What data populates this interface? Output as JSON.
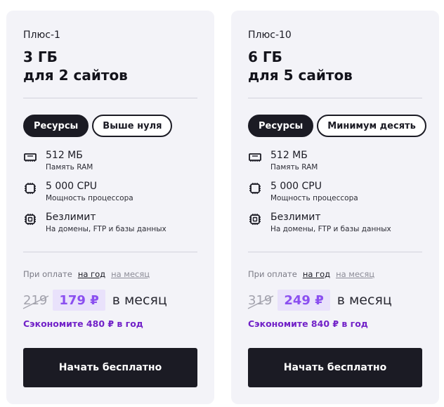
{
  "plans": [
    {
      "name": "Плюс-1",
      "title_line1": "3 ГБ",
      "title_line2": "для 2 сайтов",
      "tabs": [
        "Ресурсы",
        "Выше нуля"
      ],
      "features": [
        {
          "icon": "ram-icon",
          "main": "512 МБ",
          "sub": "Память RAM"
        },
        {
          "icon": "cpu-icon",
          "main": "5 000 CPU",
          "sub": "Мощность процессора"
        },
        {
          "icon": "chip-icon",
          "main": "Безлимит",
          "sub": "На домены, FTP и базы данных"
        }
      ],
      "payment_prefix": "При оплате",
      "payment_options": [
        "на год",
        "на месяц"
      ],
      "old_price": "219",
      "new_price": "179 ₽",
      "period": "в месяц",
      "savings": "Сэкономите 480 ₽ в год",
      "cta": "Начать бесплатно"
    },
    {
      "name": "Плюс-10",
      "title_line1": "6 ГБ",
      "title_line2": "для 5 сайтов",
      "tabs": [
        "Ресурсы",
        "Минимум десять"
      ],
      "features": [
        {
          "icon": "ram-icon",
          "main": "512 МБ",
          "sub": "Память RAM"
        },
        {
          "icon": "cpu-icon",
          "main": "5 000 CPU",
          "sub": "Мощность процессора"
        },
        {
          "icon": "chip-icon",
          "main": "Безлимит",
          "sub": "На домены, FTP и базы данных"
        }
      ],
      "payment_prefix": "При оплате",
      "payment_options": [
        "на год",
        "на месяц"
      ],
      "old_price": "319",
      "new_price": "249 ₽",
      "period": "в месяц",
      "savings": "Сэкономите 840 ₽ в год",
      "cta": "Начать бесплатно"
    }
  ],
  "colors": {
    "card_bg": "#f3f3f8",
    "dark": "#1b1b24",
    "price_accent": "#8b4ff0",
    "price_bg": "#e9e2fb",
    "savings": "#7222c8"
  }
}
